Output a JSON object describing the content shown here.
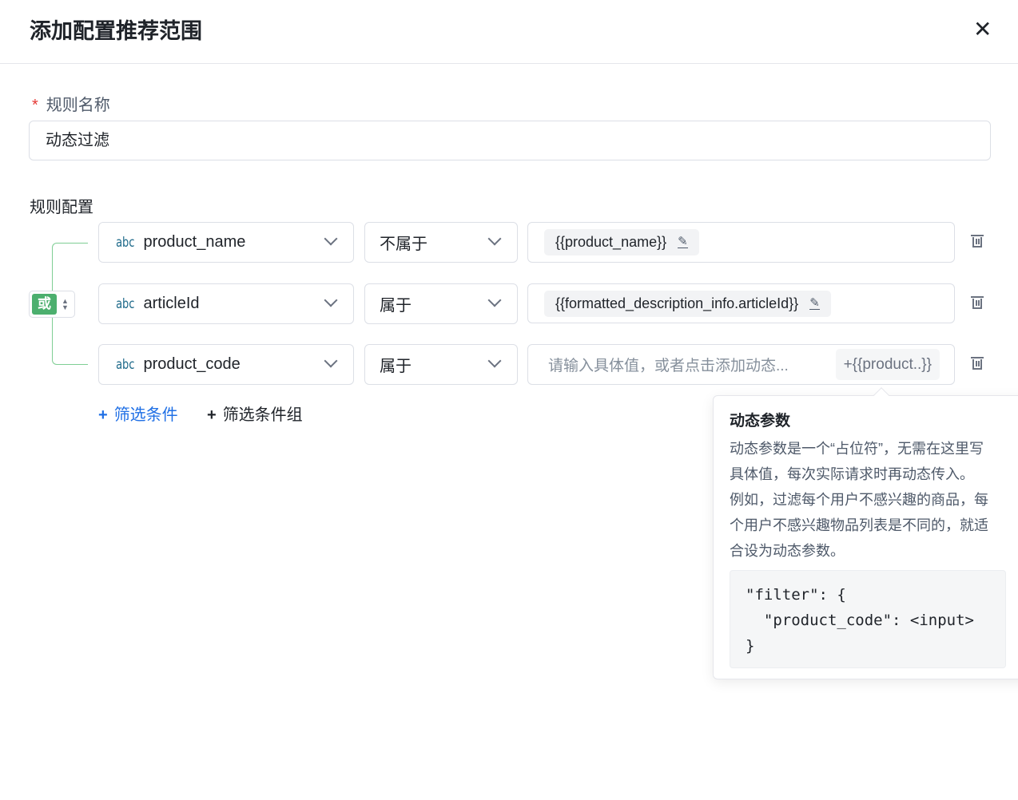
{
  "dialog": {
    "title": "添加配置推荐范围"
  },
  "rule_name": {
    "label": "规则名称",
    "required_mark": "*",
    "value": "动态过滤"
  },
  "rule_config": {
    "label": "规则配置",
    "logic": "或",
    "conditions": [
      {
        "type_icon": "abc",
        "field": "product_name",
        "operator": "不属于",
        "value_tag": "{{product_name}}"
      },
      {
        "type_icon": "abc",
        "field": "articleId",
        "operator": "属于",
        "value_tag": "{{formatted_description_info.articleId}}"
      },
      {
        "type_icon": "abc",
        "field": "product_code",
        "operator": "属于",
        "placeholder": "请输入具体值，或者点击添加动态...",
        "add_param": "+{{product..}}"
      }
    ],
    "add_condition": "筛选条件",
    "add_group": "筛选条件组",
    "plus": "+"
  },
  "popover": {
    "title": "动态参数",
    "lines": [
      "动态参数是一个“占位符”，无需在这里写",
      "具体值，每次实际请求时再动态传入。",
      "例如，过滤每个用户不感兴趣的商品，每",
      "个用户不感兴趣物品列表是不同的，就适",
      "合设为动态参数。"
    ],
    "code": [
      "\"filter\": {",
      "  \"product_code\": <input>",
      "}"
    ]
  },
  "colors": {
    "accent": "#1f6fe5",
    "logic": "#4caf6e"
  }
}
